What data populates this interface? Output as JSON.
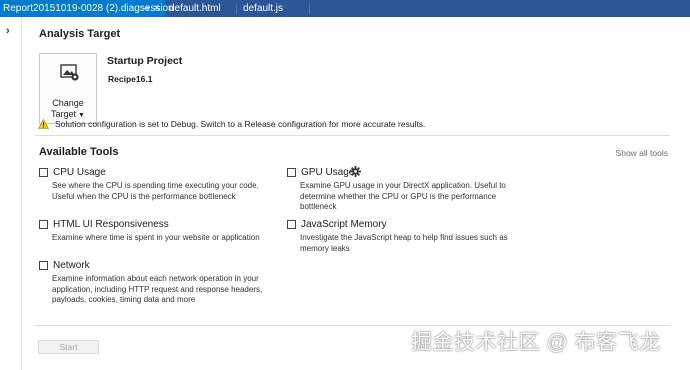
{
  "tabs": [
    {
      "label": "Report20151019-0028 (2).diagsession",
      "active": true,
      "pin_icon": "pin-icon",
      "close_icon": "close-icon"
    },
    {
      "label": "default.html",
      "active": false
    },
    {
      "label": "default.js",
      "active": false
    }
  ],
  "gutter": {
    "expand_icon": "chevron-right-icon",
    "glyph": "›"
  },
  "analysis_target": {
    "title": "Analysis Target",
    "change_target": {
      "label_line1": "Change",
      "label_line2": "Target",
      "caret": "▼",
      "icon": "target-image-gear-icon"
    },
    "project_name": "Startup Project",
    "project_subtitle": "Recipe16.1",
    "warning_icon": "warning-icon",
    "warning_text": "Solution configuration is set to Debug. Switch to a Release configuration for more accurate results."
  },
  "available_tools": {
    "title": "Available Tools",
    "show_all": "Show all tools",
    "tools": [
      {
        "name": "CPU Usage",
        "checked": false,
        "description": "See where the CPU is spending time executing your code. Useful when the CPU is the performance bottleneck"
      },
      {
        "name": "GPU Usage",
        "checked": false,
        "has_settings": true,
        "settings_icon": "gear-icon",
        "description": "Examine GPU usage in your DirectX application. Useful to determine whether the CPU or GPU is the performance bottleneck"
      },
      {
        "name": "HTML UI Responsiveness",
        "checked": false,
        "description": "Examine where time is spent in your website or application"
      },
      {
        "name": "JavaScript Memory",
        "checked": false,
        "description": "Investigate the JavaScript heap to help find issues such as memory leaks"
      },
      {
        "name": "Network",
        "checked": false,
        "description": "Examine information about each network operation in your application, including HTTP request and response headers, payloads, cookies, timing data and more"
      }
    ]
  },
  "start_button": {
    "label": "Start",
    "enabled": false
  },
  "watermark": "掘金技术社区 @ 布客飞龙",
  "colors": {
    "tab_active": "#007acc",
    "tab_strip": "#2b5797",
    "warning": "#f2c811",
    "divider": "#dcdcdc"
  }
}
